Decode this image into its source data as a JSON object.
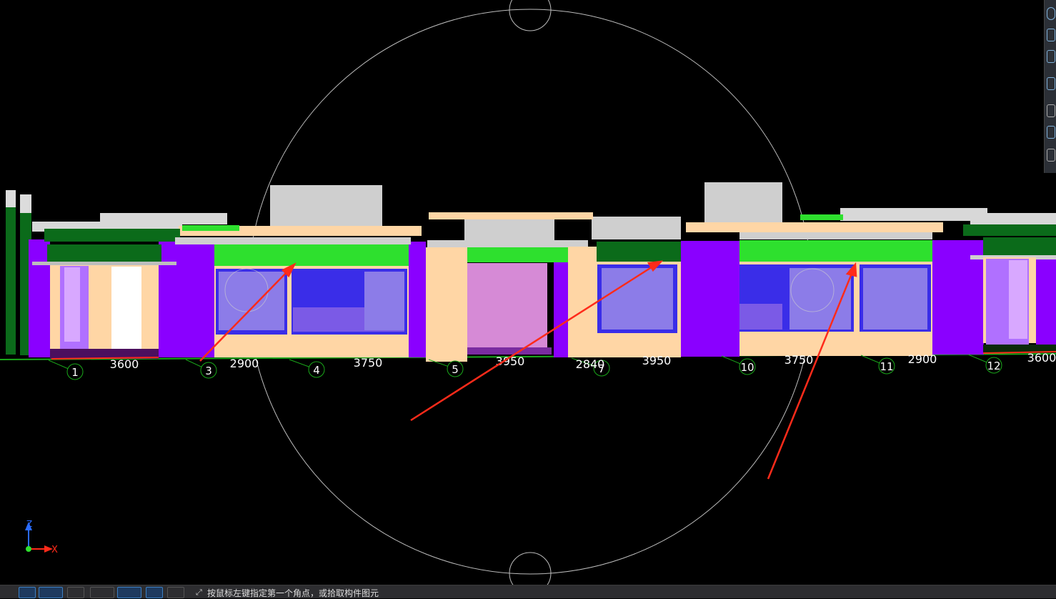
{
  "axis_labels": [
    {
      "id": "1",
      "label": "1"
    },
    {
      "id": "3",
      "label": "3"
    },
    {
      "id": "4",
      "label": "4"
    },
    {
      "id": "5",
      "label": "5"
    },
    {
      "id": "7",
      "label": "7"
    },
    {
      "id": "10",
      "label": "10"
    },
    {
      "id": "11",
      "label": "11"
    },
    {
      "id": "12",
      "label": "12"
    }
  ],
  "dimensions": [
    "3600",
    "2900",
    "3750",
    "3950",
    "2840",
    "3950",
    "3750",
    "2900",
    "3600"
  ],
  "coordinate_indicator": {
    "z_label": "Z",
    "x_label": "X"
  },
  "status": {
    "prompt_text": "按鼠标左键指定第一个角点，或拾取构件图元"
  },
  "colors": {
    "background": "#000000",
    "wall_purple": "#8a00ff",
    "beam_green": "#2ee02e",
    "dark_green": "#0b6b1a",
    "slab_peach": "#ffd6a5",
    "window_blue": "#3a2de8",
    "arrow_red": "#ff2b1a",
    "grid_green": "#1aa81a"
  },
  "icons": {
    "status_icon": "pick-corner-icon"
  }
}
